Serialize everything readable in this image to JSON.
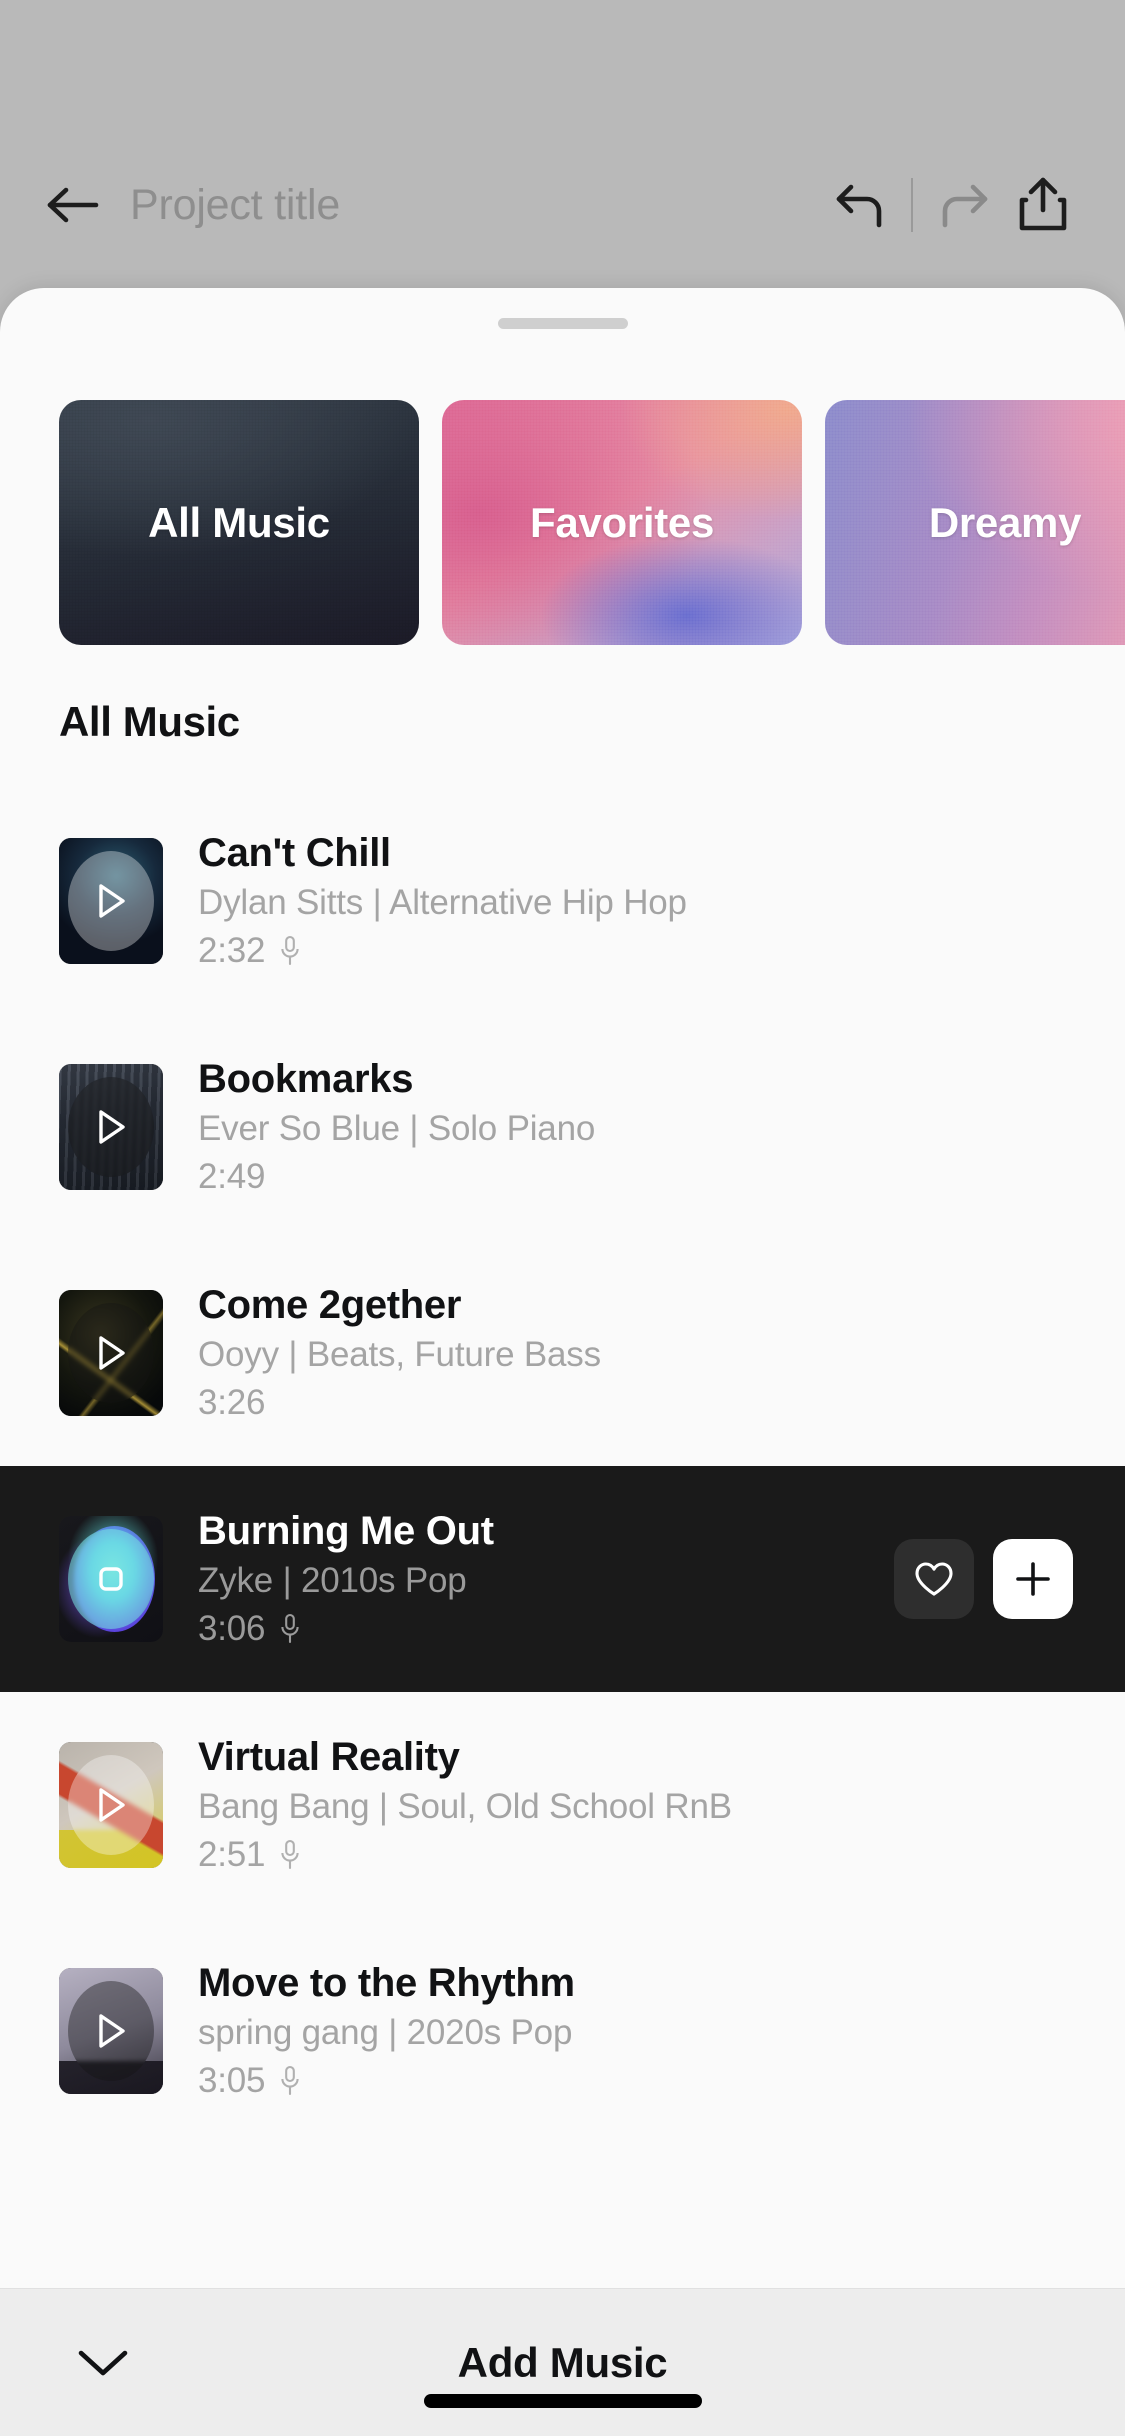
{
  "editor": {
    "project_title": "Project title",
    "back_icon": "arrow-left-icon",
    "undo_icon": "undo-icon",
    "redo_icon": "redo-icon",
    "share_icon": "share-upload-icon"
  },
  "sheet": {
    "grabber": "drag-handle"
  },
  "categories": [
    {
      "label": "All Music",
      "style": "card-all",
      "selected": true
    },
    {
      "label": "Favorites",
      "style": "card-fav",
      "selected": false
    },
    {
      "label": "Dreamy",
      "style": "card-dreamy",
      "selected": false
    }
  ],
  "section": {
    "title": "All Music"
  },
  "tracks": [
    {
      "title": "Can't Chill",
      "subtitle": "Dylan Sitts | Alternative Hip Hop",
      "duration": "2:32",
      "has_vocals": true,
      "selected": false,
      "art": "art-1",
      "bubble": "light"
    },
    {
      "title": "Bookmarks",
      "subtitle": "Ever So Blue | Solo Piano",
      "duration": "2:49",
      "has_vocals": false,
      "selected": false,
      "art": "art-2",
      "bubble": "dark"
    },
    {
      "title": "Come 2gether",
      "subtitle": "Ooyy | Beats, Future Bass",
      "duration": "3:26",
      "has_vocals": false,
      "selected": false,
      "art": "art-3",
      "bubble": "dark"
    },
    {
      "title": "Burning Me Out",
      "subtitle": "Zyke | 2010s Pop",
      "duration": "3:06",
      "has_vocals": true,
      "selected": true,
      "art": "art-4",
      "bubble": "teal",
      "actions": {
        "like_icon": "heart-icon",
        "add_icon": "plus-icon"
      }
    },
    {
      "title": "Virtual Reality",
      "subtitle": "Bang Bang | Soul, Old School RnB",
      "duration": "2:51",
      "has_vocals": true,
      "selected": false,
      "art": "art-5",
      "bubble": "light"
    },
    {
      "title": "Move to the Rhythm",
      "subtitle": "spring gang | 2020s Pop",
      "duration": "3:05",
      "has_vocals": true,
      "selected": false,
      "art": "art-6",
      "bubble": "dark"
    }
  ],
  "bottom_bar": {
    "collapse_icon": "chevron-down-icon",
    "title": "Add Music"
  },
  "colors": {
    "sheet_bg": "#fafafa",
    "selected_row_bg": "#1a1a1a",
    "backdrop": "#b9b9b9",
    "bottom_bar_bg": "#ededed",
    "muted_text": "#a4a4a4",
    "primary_text": "#111214"
  }
}
